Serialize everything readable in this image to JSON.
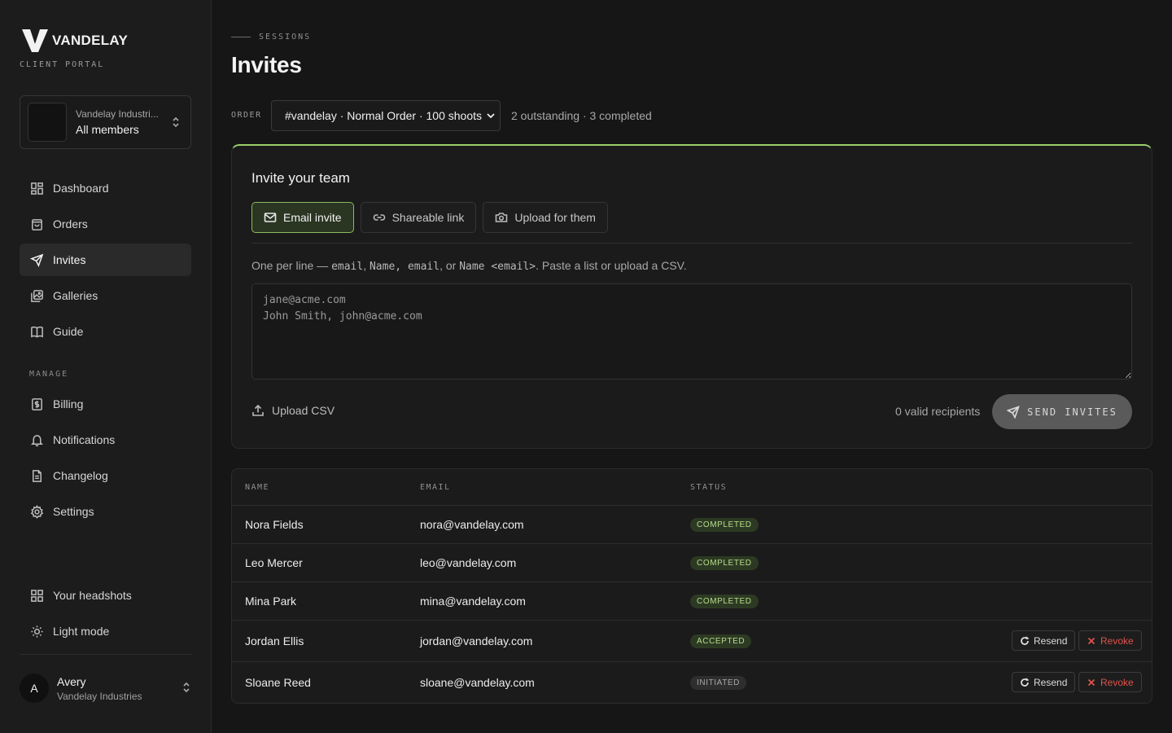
{
  "brand": {
    "name": "VANDELAY",
    "subtitle": "CLIENT PORTAL"
  },
  "org_switcher": {
    "org_name": "Vandelay Industri...",
    "scope": "All members"
  },
  "nav": {
    "primary": [
      {
        "label": "Dashboard",
        "icon": "dashboard-icon"
      },
      {
        "label": "Orders",
        "icon": "shopping-bag-icon"
      },
      {
        "label": "Invites",
        "icon": "send-icon",
        "active": true
      },
      {
        "label": "Galleries",
        "icon": "gallery-icon"
      },
      {
        "label": "Guide",
        "icon": "book-icon"
      }
    ],
    "section_label": "MANAGE",
    "manage": [
      {
        "label": "Billing",
        "icon": "billing-icon"
      },
      {
        "label": "Notifications",
        "icon": "bell-icon"
      },
      {
        "label": "Changelog",
        "icon": "document-icon"
      },
      {
        "label": "Settings",
        "icon": "gear-icon"
      }
    ],
    "footer": [
      {
        "label": "Your headshots",
        "icon": "grid-icon"
      },
      {
        "label": "Light mode",
        "icon": "sun-icon"
      }
    ]
  },
  "user": {
    "initial": "A",
    "name": "Avery",
    "org": "Vandelay Industries"
  },
  "header": {
    "breadcrumb": "SESSIONS",
    "title": "Invites"
  },
  "order": {
    "label": "ORDER",
    "selected": "#vandelay · Normal Order · 100 shoots",
    "meta": "2 outstanding · 3 completed"
  },
  "invite": {
    "title": "Invite your team",
    "tabs": [
      {
        "label": "Email invite",
        "icon": "mail-icon",
        "active": true
      },
      {
        "label": "Shareable link",
        "icon": "link-icon"
      },
      {
        "label": "Upload for them",
        "icon": "camera-icon"
      }
    ],
    "hint": {
      "prefix": "One per line — ",
      "code1": "email",
      "sep1": ", ",
      "code2": "Name, email",
      "sep2": ", or ",
      "code3": "Name <email>",
      "suffix": ". Paste a list or upload a CSV."
    },
    "textarea_placeholder": "jane@acme.com\nJohn Smith, john@acme.com",
    "upload_csv_label": "Upload CSV",
    "valid_recipients": "0 valid recipients",
    "send_label": "SEND INVITES"
  },
  "table": {
    "columns": [
      "NAME",
      "EMAIL",
      "STATUS"
    ],
    "rows": [
      {
        "name": "Nora Fields",
        "email": "nora@vandelay.com",
        "status": "COMPLETED"
      },
      {
        "name": "Leo Mercer",
        "email": "leo@vandelay.com",
        "status": "COMPLETED"
      },
      {
        "name": "Mina Park",
        "email": "mina@vandelay.com",
        "status": "COMPLETED"
      },
      {
        "name": "Jordan Ellis",
        "email": "jordan@vandelay.com",
        "status": "ACCEPTED",
        "actions": true
      },
      {
        "name": "Sloane Reed",
        "email": "sloane@vandelay.com",
        "status": "INITIATED",
        "actions": true
      }
    ],
    "resend_label": "Resend",
    "revoke_label": "Revoke"
  },
  "colors": {
    "accent": "#9ccf6a",
    "danger": "#e0524a",
    "background": "#161616"
  }
}
